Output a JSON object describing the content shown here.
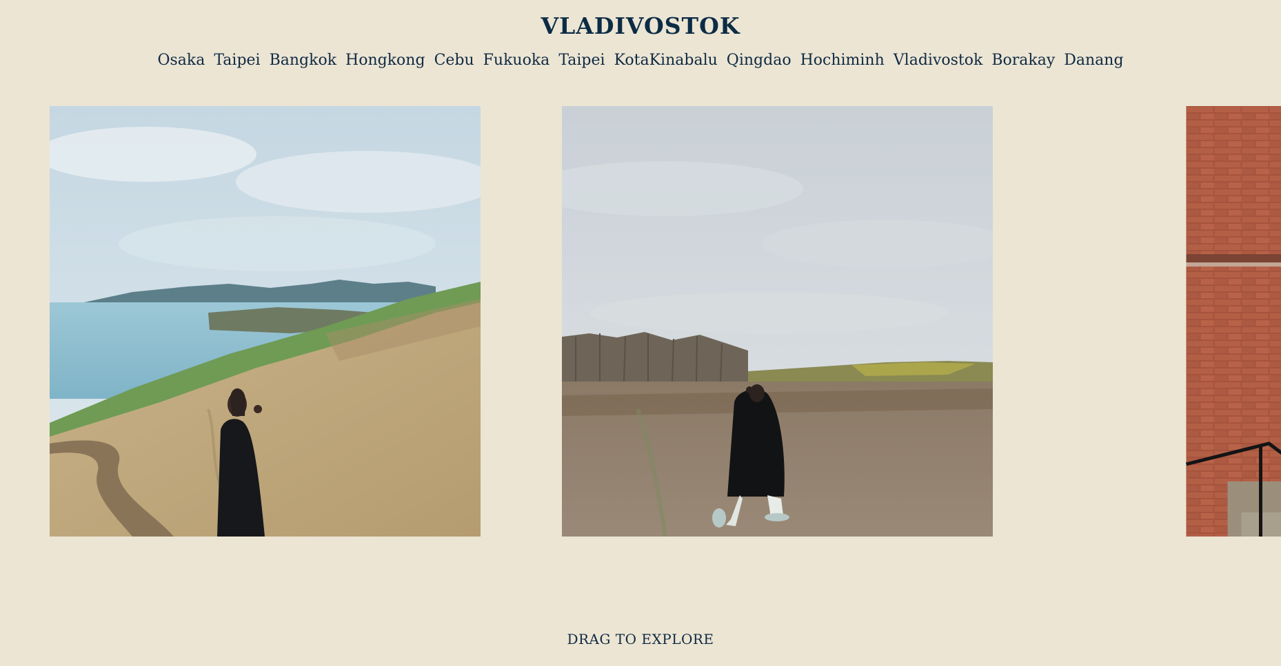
{
  "header": {
    "title": "VLADIVOSTOK"
  },
  "nav": {
    "items": [
      {
        "label": "Osaka"
      },
      {
        "label": "Taipei"
      },
      {
        "label": "Bangkok"
      },
      {
        "label": "Hongkong"
      },
      {
        "label": "Cebu"
      },
      {
        "label": "Fukuoka"
      },
      {
        "label": "Taipei"
      },
      {
        "label": "KotaKinabalu"
      },
      {
        "label": "Qingdao"
      },
      {
        "label": "Hochiminh"
      },
      {
        "label": "Vladivostok"
      },
      {
        "label": "Borakay"
      },
      {
        "label": "Danang"
      }
    ]
  },
  "gallery": {
    "photos": [
      {
        "icon": "coastal-cliff-photo"
      },
      {
        "icon": "field-walking-photo"
      },
      {
        "icon": "brick-wall-photo"
      }
    ]
  },
  "footer": {
    "hint": "DRAG TO EXPLORE"
  },
  "colors": {
    "background": "#ece5d3",
    "text": "#0f2a44"
  }
}
